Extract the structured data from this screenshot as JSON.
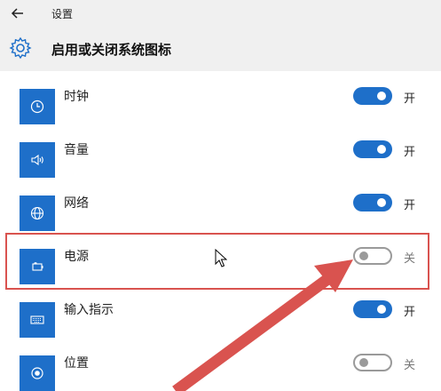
{
  "window": {
    "title": "设置"
  },
  "header": {
    "title": "启用或关闭系统图标"
  },
  "items": [
    {
      "label": "时钟",
      "icon": "clock-icon",
      "state": "开",
      "on": true
    },
    {
      "label": "音量",
      "icon": "volume-icon",
      "state": "开",
      "on": true
    },
    {
      "label": "网络",
      "icon": "network-icon",
      "state": "开",
      "on": true
    },
    {
      "label": "电源",
      "icon": "power-icon",
      "state": "关",
      "on": false
    },
    {
      "label": "输入指示",
      "icon": "keyboard-icon",
      "state": "开",
      "on": true
    },
    {
      "label": "位置",
      "icon": "location-icon",
      "state": "关",
      "on": false
    }
  ],
  "colors": {
    "accent": "#1e6fc9",
    "annotation": "#d9534f"
  }
}
